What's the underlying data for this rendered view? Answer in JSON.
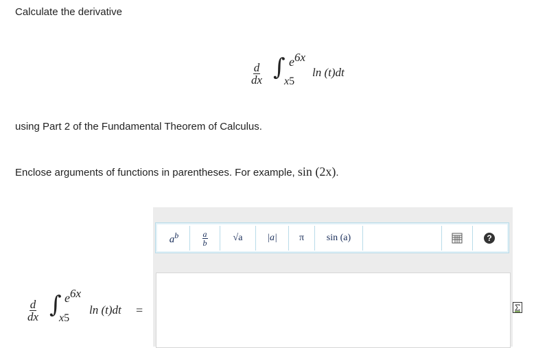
{
  "question": {
    "title": "Calculate the derivative",
    "instruction": "using Part 2 of the Fundamental Theorem of Calculus.",
    "enclose_prefix": "Enclose arguments of functions in parentheses. For example,",
    "enclose_example": "sin (2x)",
    "enclose_suffix": "."
  },
  "expression": {
    "d_num": "d",
    "d_den": "dx",
    "integral_sign": "∫",
    "lower_limit_base": "x",
    "lower_limit_exp": "5",
    "upper_limit_base": "e",
    "upper_limit_exp": "6x",
    "integrand": "ln (t)dt",
    "equals": "="
  },
  "toolbar": {
    "power_base": "a",
    "power_exp": "b",
    "frac_num": "a",
    "frac_den": "b",
    "sqrt_label": "√a",
    "abs_label": "|a|",
    "pi_label": "π",
    "sin_label": "sin (a)",
    "help_label": "?"
  },
  "icons": {
    "keyboard": "keyboard-icon",
    "help": "help-icon",
    "formula": "formula-icon"
  },
  "colors": {
    "panel": "#ececec",
    "toolbar_border": "#b8dbe9",
    "icon_dark": "#1a2e5a"
  }
}
